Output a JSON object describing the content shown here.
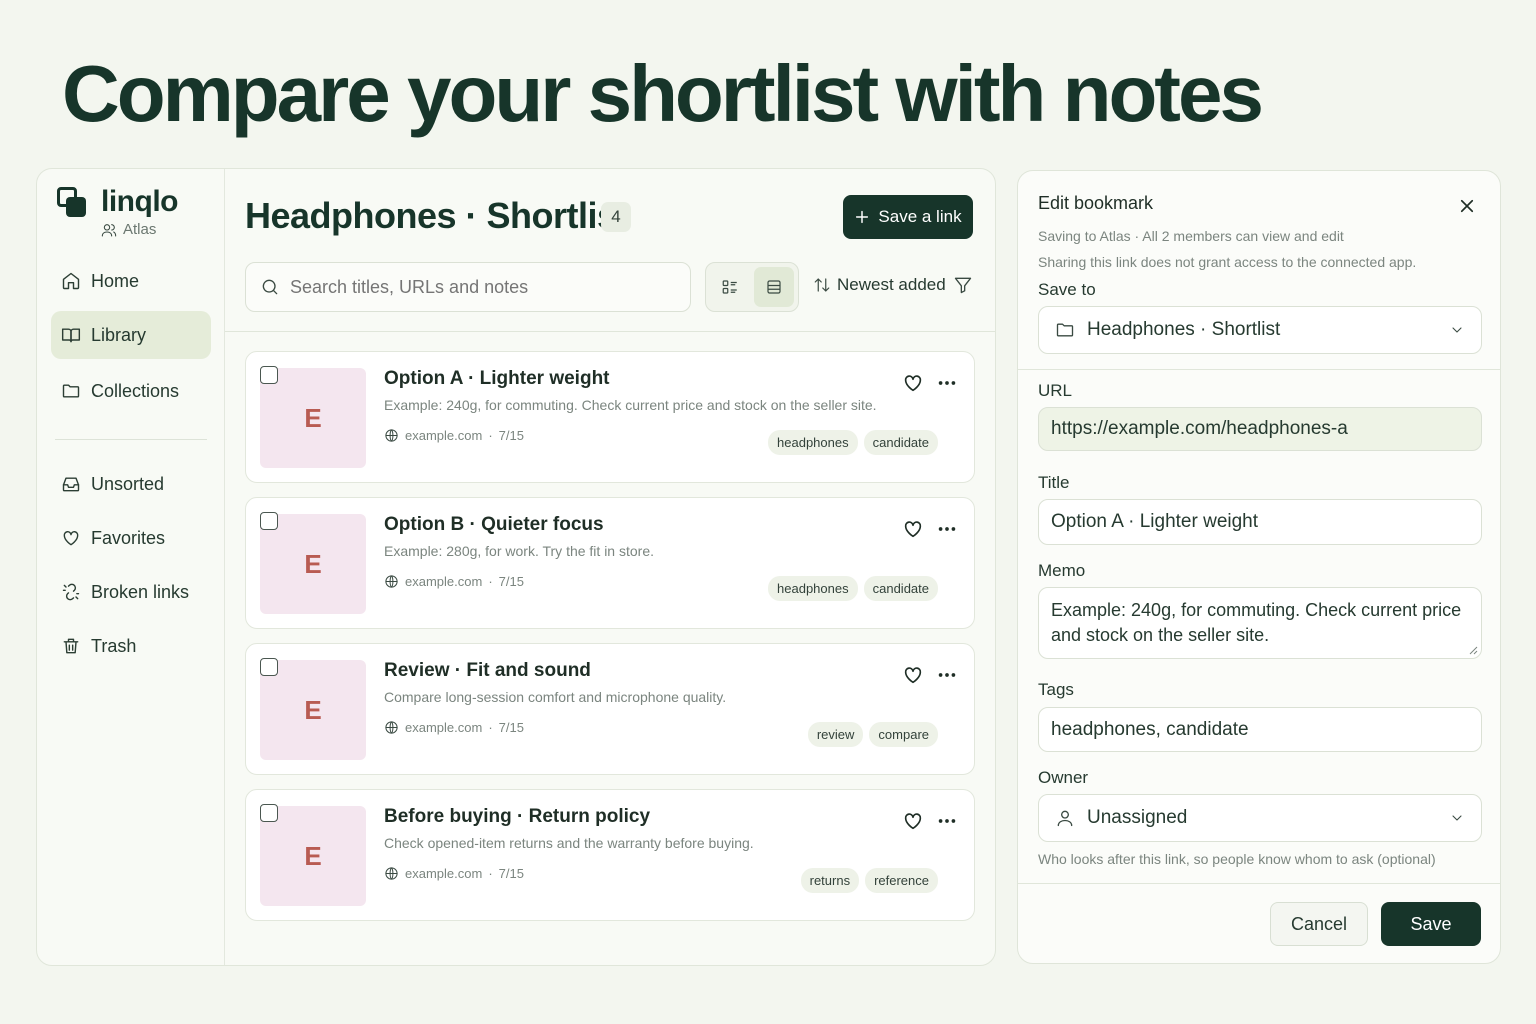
{
  "headline": "Compare your shortlist with notes",
  "sidebar": {
    "brand": "linqlo",
    "workspace": "Atlas",
    "items": [
      {
        "label": "Home",
        "icon": "home-icon"
      },
      {
        "label": "Library",
        "icon": "book-icon",
        "active": true
      },
      {
        "label": "Collections",
        "icon": "folder-icon"
      },
      {
        "label": "Unsorted",
        "icon": "inbox-icon"
      },
      {
        "label": "Favorites",
        "icon": "heart-icon"
      },
      {
        "label": "Broken links",
        "icon": "broken-link-icon"
      },
      {
        "label": "Trash",
        "icon": "trash-icon"
      }
    ]
  },
  "main": {
    "title": "Headphones · Shortlist",
    "count": "4",
    "save_link_label": "Save a link",
    "search_placeholder": "Search titles, URLs and notes",
    "sort_label": "Newest added",
    "cards": [
      {
        "thumb": "E",
        "title": "Option A · Lighter weight",
        "desc": "Example: 240g, for commuting. Check current price and stock on the seller site.",
        "domain": "example.com",
        "date": "7/15",
        "tags": [
          "headphones",
          "candidate"
        ]
      },
      {
        "thumb": "E",
        "title": "Option B · Quieter focus",
        "desc": "Example: 280g, for work. Try the fit in store.",
        "domain": "example.com",
        "date": "7/15",
        "tags": [
          "headphones",
          "candidate"
        ]
      },
      {
        "thumb": "E",
        "title": "Review · Fit and sound",
        "desc": "Compare long-session comfort and microphone quality.",
        "domain": "example.com",
        "date": "7/15",
        "tags": [
          "review",
          "compare"
        ]
      },
      {
        "thumb": "E",
        "title": "Before buying · Return policy",
        "desc": "Check opened-item returns and the warranty before buying.",
        "domain": "example.com",
        "date": "7/15",
        "tags": [
          "returns",
          "reference"
        ]
      }
    ]
  },
  "panel": {
    "title": "Edit bookmark",
    "sub1": "Saving to Atlas · All 2 members can view and edit",
    "sub2": "Sharing this link does not grant access to the connected app.",
    "save_to_label": "Save to",
    "save_to_value": "Headphones · Shortlist",
    "url_label": "URL",
    "url_value": "https://example.com/headphones-a",
    "title_label": "Title",
    "title_value": "Option A · Lighter weight",
    "memo_label": "Memo",
    "memo_value": "Example: 240g, for commuting. Check current price and stock on the seller site.",
    "tags_label": "Tags",
    "tags_value": "headphones, candidate",
    "owner_label": "Owner",
    "owner_value": "Unassigned",
    "owner_hint": "Who looks after this link, so people know whom to ask (optional)",
    "cancel_label": "Cancel",
    "save_label": "Save"
  },
  "colors": {
    "brand": "#17352a",
    "active_nav": "#e5ecd9",
    "thumb_bg": "#f4e6ef",
    "thumb_letter": "#b85b52"
  }
}
